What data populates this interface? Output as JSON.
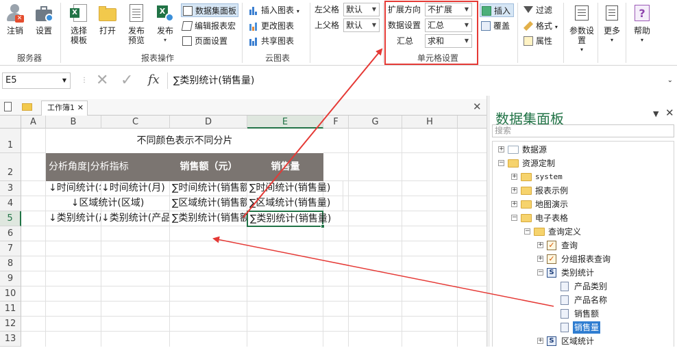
{
  "ribbon": {
    "logout": "注销",
    "settings": "设置",
    "group_server": "服务器",
    "select_template": "选择\n模板",
    "open": "打开",
    "publish_preview": "发布\n预览",
    "publish": "发布",
    "group_report_ops": "报表操作",
    "data_panel": "数据集面板",
    "edit_macro": "编辑报表宏",
    "page_setup": "页面设置",
    "insert_chart": "插入图表",
    "change_chart": "更改图表",
    "share_chart": "共享图表",
    "group_cloud_chart": "云图表",
    "left_parent_label": "左父格",
    "left_parent_value": "默认",
    "top_parent_label": "上父格",
    "top_parent_value": "默认",
    "expand_dir_label": "扩展方向",
    "expand_dir_value": "不扩展",
    "data_setting_label": "数据设置",
    "data_setting_value": "汇总",
    "summary_label": "汇总",
    "summary_value": "求和",
    "group_cell_settings": "单元格设置",
    "insert": "插入",
    "overwrite": "覆盖",
    "filter": "过滤",
    "format": "格式",
    "properties": "属性",
    "param_settings": "参数设置",
    "more": "更多",
    "help": "帮助"
  },
  "formula_bar": {
    "cell_ref": "E5",
    "fx": "fx",
    "formula": "∑类别统计(销售量)"
  },
  "workbook": {
    "tab_label": "工作簿1",
    "columns": [
      "A",
      "B",
      "C",
      "D",
      "E",
      "F",
      "G",
      "H"
    ],
    "rows": [
      "1",
      "2",
      "3",
      "4",
      "5",
      "6",
      "7",
      "8",
      "9",
      "10",
      "11",
      "12",
      "13"
    ],
    "title": "不同颜色表示不同分片",
    "header_analysis": "分析角度|分析指标",
    "header_sales_amount": "销售额（元）",
    "header_sales_qty": "销售量",
    "r3_b": "↓时间统计(年)",
    "r3_c": "↓时间统计(月)",
    "r3_d": "∑时间统计(销售额)",
    "r3_e": "∑时间统计(销售量)",
    "r4_bc": "↓区域统计(区域)",
    "r4_d": "∑区域统计(销售额)",
    "r4_e": "∑区域统计(销售量)",
    "r5_b": "↓类别统计(产品类别)",
    "r5_c": "↓类别统计(产品名称)",
    "r5_d": "∑类别统计(销售额)",
    "r5_e": "∑类别统计(销售量)"
  },
  "panel": {
    "title": "数据集面板",
    "search_placeholder": "搜索",
    "tree": {
      "datasource": "数据源",
      "resources": "资源定制",
      "system": "system",
      "report_samples": "报表示例",
      "map_demo": "地图演示",
      "spreadsheet": "电子表格",
      "query_def": "查询定义",
      "query": "查询",
      "group_query": "分组报表查询",
      "category_stats": "类别统计",
      "product_category": "产品类别",
      "product_name": "产品名称",
      "sales_amount": "销售额",
      "sales_qty": "销售量",
      "region_stats": "区域统计"
    }
  },
  "colors": {
    "header_fill": "#7b7571",
    "selection_green": "#217346",
    "annotation_red": "#e53935",
    "tree_highlight": "#2f7dd1"
  }
}
